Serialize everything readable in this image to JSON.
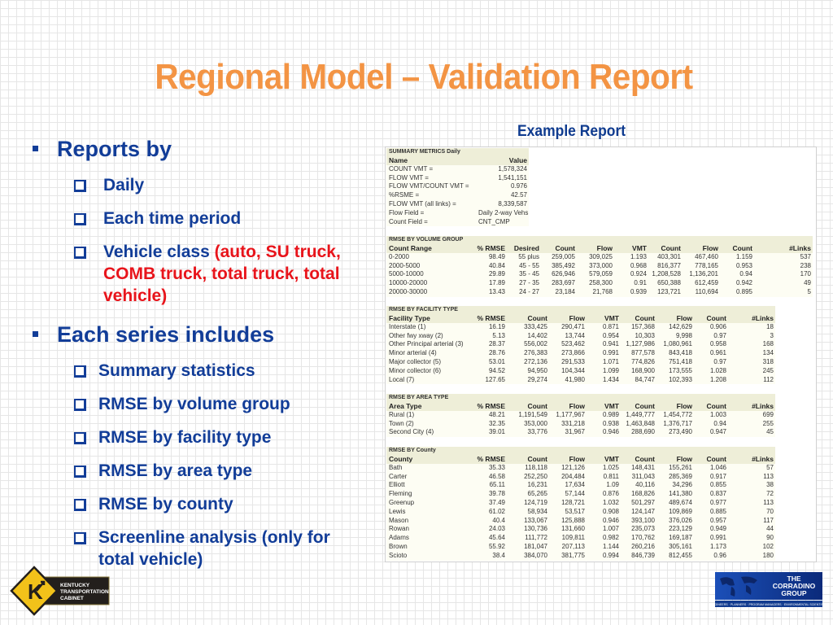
{
  "title": "Regional Model – Validation Report",
  "example_label": "Example Report",
  "bullets": {
    "reports_by": {
      "label": "Reports by",
      "items": [
        {
          "text": "Daily"
        },
        {
          "text": "Each time period"
        },
        {
          "text": "Vehicle class ",
          "highlight_line1": "(auto, SU truck,",
          "line2": "COMB truck, total truck, total",
          "line3": "vehicle)"
        }
      ]
    },
    "each_series": {
      "label": "Each series includes",
      "items": [
        {
          "text": "Summary statistics"
        },
        {
          "text": "RMSE by volume group"
        },
        {
          "text": "RMSE by facility type"
        },
        {
          "text": "RMSE by area type"
        },
        {
          "text": "RMSE by county"
        },
        {
          "text": "Screenline analysis (only for",
          "line2": "total vehicle)"
        }
      ]
    }
  },
  "colors": {
    "title": "#f39444",
    "bullet_text": "#123d98",
    "highlight": "#e8141b",
    "table_header_band": "#eeeed8",
    "table_body": "#fdfdf3"
  },
  "report": {
    "summary": {
      "title": "SUMMARY METRICS Daily",
      "headers": [
        "Name",
        "Value"
      ],
      "rows": [
        [
          "COUNT VMT =",
          "1,578,324"
        ],
        [
          "FLOW VMT =",
          "1,541,151"
        ],
        [
          "FLOW VMT/COUNT VMT =",
          "0.976"
        ],
        [
          "%RSME =",
          "42.57"
        ],
        [
          "FLOW VMT (all links) =",
          "8,339,587"
        ],
        [
          "Flow Field =",
          "Daily 2-way Vehs"
        ],
        [
          "Count Field =",
          "CNT_CMP"
        ]
      ]
    },
    "volume_group": {
      "title": "RMSE BY VOLUME GROUP",
      "headers": [
        "Count Range",
        "% RMSE",
        "Desired",
        "Count",
        "Flow",
        "VMT",
        "Count",
        "Flow",
        "Count",
        "#Links"
      ],
      "rows": [
        [
          "0-2000",
          "98.49",
          "55 plus",
          "259,005",
          "309,025",
          "1.193",
          "403,301",
          "467,460",
          "1.159",
          "537"
        ],
        [
          "2000-5000",
          "40.84",
          "45 - 55",
          "385,492",
          "373,000",
          "0.968",
          "816,377",
          "778,165",
          "0.953",
          "238"
        ],
        [
          "5000-10000",
          "29.89",
          "35 - 45",
          "626,946",
          "579,059",
          "0.924",
          "1,208,528",
          "1,136,201",
          "0.94",
          "170"
        ],
        [
          "10000-20000",
          "17.89",
          "27 - 35",
          "283,697",
          "258,300",
          "0.91",
          "650,388",
          "612,459",
          "0.942",
          "49"
        ],
        [
          "20000-30000",
          "13.43",
          "24 - 27",
          "23,184",
          "21,768",
          "0.939",
          "123,721",
          "110,694",
          "0.895",
          "5"
        ]
      ]
    },
    "facility_type": {
      "title": "RMSE BY FACILITY TYPE",
      "headers": [
        "Facility Type",
        "% RMSE",
        "Count",
        "Flow",
        "VMT",
        "Count",
        "Flow",
        "Count",
        "#Links"
      ],
      "rows": [
        [
          "Interstate (1)",
          "16.19",
          "333,425",
          "290,471",
          "0.871",
          "157,368",
          "142,629",
          "0.906",
          "18"
        ],
        [
          "Other fwy xway (2)",
          "5.13",
          "14,402",
          "13,744",
          "0.954",
          "10,303",
          "9,998",
          "0.97",
          "3"
        ],
        [
          "Other Principal arterial (3)",
          "28.37",
          "556,002",
          "523,462",
          "0.941",
          "1,127,986",
          "1,080,961",
          "0.958",
          "168"
        ],
        [
          "Minor arterial (4)",
          "28.76",
          "276,383",
          "273,866",
          "0.991",
          "877,578",
          "843,418",
          "0.961",
          "134"
        ],
        [
          "Major collector (5)",
          "53.01",
          "272,136",
          "291,533",
          "1.071",
          "774,826",
          "751,418",
          "0.97",
          "318"
        ],
        [
          "Minor collector (6)",
          "94.52",
          "94,950",
          "104,344",
          "1.099",
          "168,900",
          "173,555",
          "1.028",
          "245"
        ],
        [
          "Local (7)",
          "127.65",
          "29,274",
          "41,980",
          "1.434",
          "84,747",
          "102,393",
          "1.208",
          "112"
        ]
      ]
    },
    "area_type": {
      "title": "RMSE BY AREA TYPE",
      "headers": [
        "Area Type",
        "% RMSE",
        "Count",
        "Flow",
        "VMT",
        "Count",
        "Flow",
        "Count",
        "#Links"
      ],
      "rows": [
        [
          "Rural (1)",
          "48.21",
          "1,191,549",
          "1,177,967",
          "0.989",
          "1,449,777",
          "1,454,772",
          "1.003",
          "699"
        ],
        [
          "Town (2)",
          "32.35",
          "353,000",
          "331,218",
          "0.938",
          "1,463,848",
          "1,376,717",
          "0.94",
          "255"
        ],
        [
          "Second City (4)",
          "39.01",
          "33,776",
          "31,967",
          "0.946",
          "288,690",
          "273,490",
          "0.947",
          "45"
        ]
      ]
    },
    "county": {
      "title": "RMSE BY County",
      "headers": [
        "County",
        "% RMSE",
        "Count",
        "Flow",
        "VMT",
        "Count",
        "Flow",
        "Count",
        "#Links"
      ],
      "rows": [
        [
          "Bath",
          "35.33",
          "118,118",
          "121,126",
          "1.025",
          "148,431",
          "155,261",
          "1.046",
          "57"
        ],
        [
          "Carter",
          "46.58",
          "252,250",
          "204,484",
          "0.811",
          "311,043",
          "285,369",
          "0.917",
          "113"
        ],
        [
          "Elliott",
          "65.11",
          "16,231",
          "17,634",
          "1.09",
          "40,116",
          "34,296",
          "0.855",
          "38"
        ],
        [
          "Fleming",
          "39.78",
          "65,265",
          "57,144",
          "0.876",
          "168,826",
          "141,380",
          "0.837",
          "72"
        ],
        [
          "Greenup",
          "37.49",
          "124,719",
          "128,721",
          "1.032",
          "501,297",
          "489,674",
          "0.977",
          "113"
        ],
        [
          "Lewis",
          "61.02",
          "58,934",
          "53,517",
          "0.908",
          "124,147",
          "109,869",
          "0.885",
          "70"
        ],
        [
          "Mason",
          "40.4",
          "133,067",
          "125,888",
          "0.946",
          "393,100",
          "376,026",
          "0.957",
          "117"
        ],
        [
          "Rowan",
          "24.03",
          "130,736",
          "131,660",
          "1.007",
          "235,073",
          "223,129",
          "0.949",
          "44"
        ],
        [
          "Adams",
          "45.64",
          "111,772",
          "109,811",
          "0.982",
          "170,762",
          "169,187",
          "0.991",
          "90"
        ],
        [
          "Brown",
          "55.92",
          "181,047",
          "207,113",
          "1.144",
          "260,216",
          "305,161",
          "1.173",
          "102"
        ],
        [
          "Scioto",
          "38.4",
          "384,070",
          "381,775",
          "0.994",
          "846,739",
          "812,455",
          "0.96",
          "180"
        ]
      ]
    }
  },
  "logos": {
    "ktc": {
      "line1": "KENTUCKY",
      "line2": "TRANSPORTATION",
      "line3": "CABINET",
      "letter": "K"
    },
    "corradino": {
      "line1": "THE",
      "line2": "CORRADINO",
      "line3": "GROUP",
      "tagline": "ENGINEERS · PLANNERS · PROGRAM MANAGERS · ENVIRONMENTAL SCIENTISTS"
    }
  }
}
